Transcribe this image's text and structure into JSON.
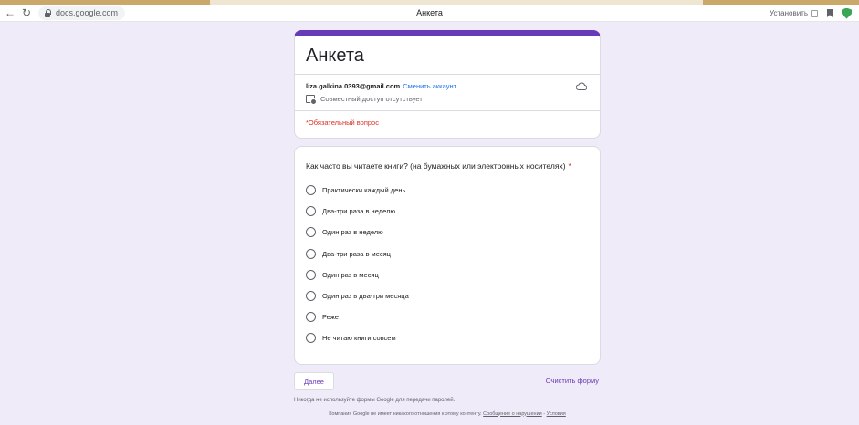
{
  "browser": {
    "url": "docs.google.com",
    "tab_title": "Анкета",
    "install_label": "Установить"
  },
  "form": {
    "title": "Анкета",
    "account_email": "liza.galkina.0393@gmail.com",
    "switch_account": "Сменить аккаунт",
    "shared_access": "Совместный доступ отсутствует",
    "required_note": "*Обязательный вопрос",
    "accent_color": "#673ab7"
  },
  "question": {
    "text": "Как часто вы читаете книги? (на бумажных или электронных носителях)",
    "required_mark": "*",
    "options": [
      "Практически каждый день",
      "Два-три раза в неделю",
      "Один раз в неделю",
      "Два-три раза в месяц",
      "Один раз в месяц",
      "Один раз в два-три месяца",
      "Реже",
      "Не читаю книги совсем"
    ]
  },
  "footer": {
    "next_label": "Далее",
    "clear_label": "Очистить форму",
    "password_warning": "Никогда не используйте формы Google для передачи паролей.",
    "disclaimer": "Компания Google не имеет никакого отношения к этому контенту.",
    "report_link": "Сообщение о нарушении",
    "terms_link": "Условия"
  }
}
